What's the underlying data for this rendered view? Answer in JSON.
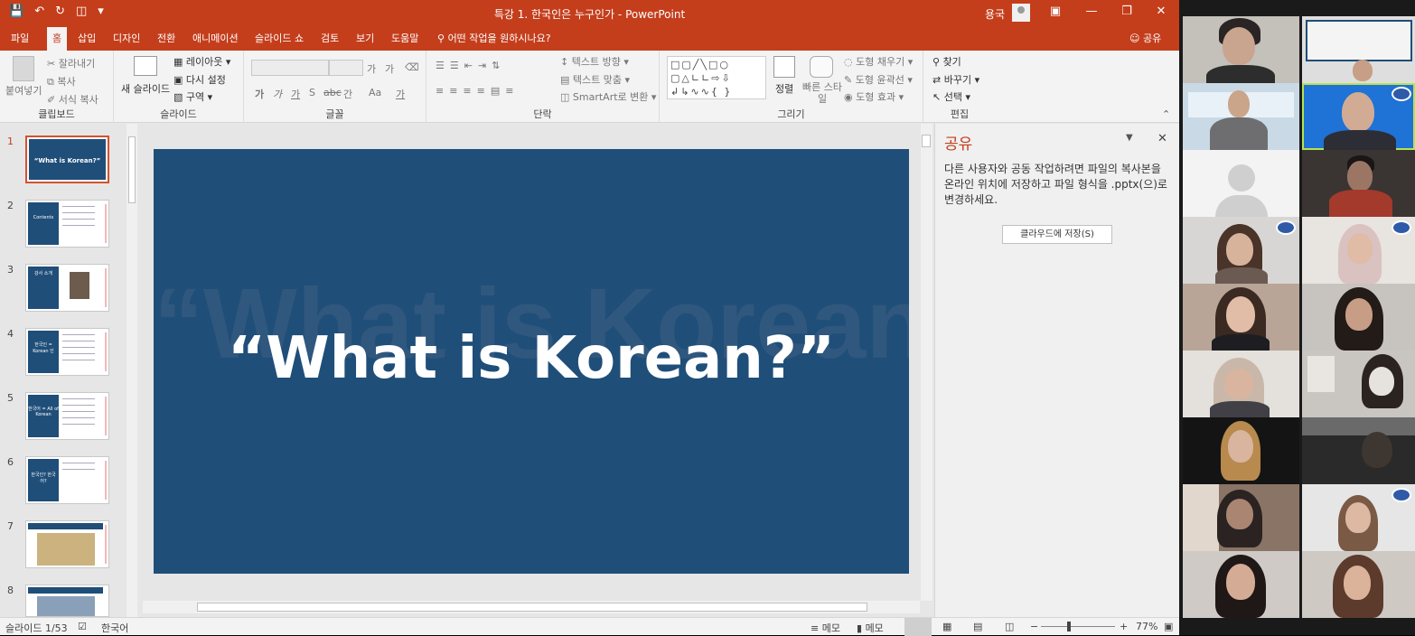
{
  "titlebar": {
    "document_title": "특강 1. 한국인은 누구인가  -  PowerPoint",
    "user_name": "용국",
    "qat_icons": [
      "save-icon",
      "undo-icon",
      "redo-icon",
      "start-presentation-icon",
      "customize-icon"
    ]
  },
  "tabs": [
    "파일",
    "홈",
    "삽입",
    "디자인",
    "전환",
    "애니메이션",
    "슬라이드 쇼",
    "검토",
    "보기",
    "도움말"
  ],
  "active_tab": "홈",
  "tell_me": "어떤 작업을 원하시나요?",
  "share_label": "공유",
  "ribbon": {
    "clipboard": {
      "label": "클립보드",
      "paste": "붙여넣기",
      "cut": "잘라내기",
      "copy": "복사",
      "format_painter": "서식 복사"
    },
    "slides": {
      "label": "슬라이드",
      "new_slide": "새 슬라이드",
      "layout": "레이아웃",
      "reset": "다시 설정",
      "section": "구역"
    },
    "font": {
      "label": "글꼴",
      "bold": "가",
      "italic": "가",
      "underline": "가",
      "shadow": "S",
      "strike": "abc",
      "spacing": "간",
      "case": "Aa",
      "color": "가",
      "grow": "가",
      "shrink": "가"
    },
    "paragraph": {
      "label": "단락",
      "text_direction": "텍스트 방향",
      "align_text": "텍스트 맞춤",
      "smartart": "SmartArt로 변환"
    },
    "drawing": {
      "label": "그리기",
      "arrange": "정렬",
      "quick_styles": "빠른 스타일",
      "fill": "도형 채우기",
      "outline": "도형 윤곽선",
      "effects": "도형 효과"
    },
    "editing": {
      "label": "편집",
      "find": "찾기",
      "replace": "바꾸기",
      "select": "선택"
    }
  },
  "slides": [
    {
      "number": "1",
      "text": "“What is Korean?”",
      "kind": "title"
    },
    {
      "number": "2",
      "text": "Contents",
      "kind": "split"
    },
    {
      "number": "3",
      "text": "강사 소개",
      "kind": "photo"
    },
    {
      "number": "4",
      "text": "한국인 = Korean 인",
      "kind": "split"
    },
    {
      "number": "5",
      "text": "한국어 = All of Korean",
      "kind": "split"
    },
    {
      "number": "6",
      "text": "한국인? 한국어?",
      "kind": "split"
    },
    {
      "number": "7",
      "text": "",
      "kind": "map"
    },
    {
      "number": "8",
      "text": "",
      "kind": "banner"
    }
  ],
  "current_slide": {
    "title": "“What is Korean?”",
    "ghost_text": "“What is Korean?”"
  },
  "share_pane": {
    "title": "공유",
    "description": "다른 사용자와 공동 작업하려면 파일의 복사본을 온라인 위치에 저장하고 파일 형식을 .pptx(으)로 변경하세요.",
    "button": "클라우드에 저장(S)"
  },
  "statusbar": {
    "slide_info": "슬라이드 1/53",
    "language": "한국어",
    "notes": "메모",
    "comments": "메모",
    "zoom": "77%"
  },
  "participants": [
    {
      "tile": "1",
      "video": true
    },
    {
      "tile": "2",
      "video": true
    },
    {
      "tile": "3",
      "video": true
    },
    {
      "tile": "4",
      "video": true
    },
    {
      "tile": "5",
      "video": false
    },
    {
      "tile": "6",
      "video": true
    },
    {
      "tile": "7",
      "video": true
    },
    {
      "tile": "8",
      "video": true
    },
    {
      "tile": "9",
      "video": true
    },
    {
      "tile": "10",
      "video": true
    },
    {
      "tile": "11",
      "video": true
    },
    {
      "tile": "12",
      "video": true
    },
    {
      "tile": "13",
      "video": true
    },
    {
      "tile": "14",
      "video": true
    },
    {
      "tile": "15",
      "video": true
    },
    {
      "tile": "16",
      "video": true
    },
    {
      "tile": "17",
      "video": true
    },
    {
      "tile": "18",
      "video": true
    }
  ],
  "colors": {
    "accent": "#c43e1c",
    "slide_background": "#1f4e79",
    "active_speaker": "#b7e34f"
  }
}
